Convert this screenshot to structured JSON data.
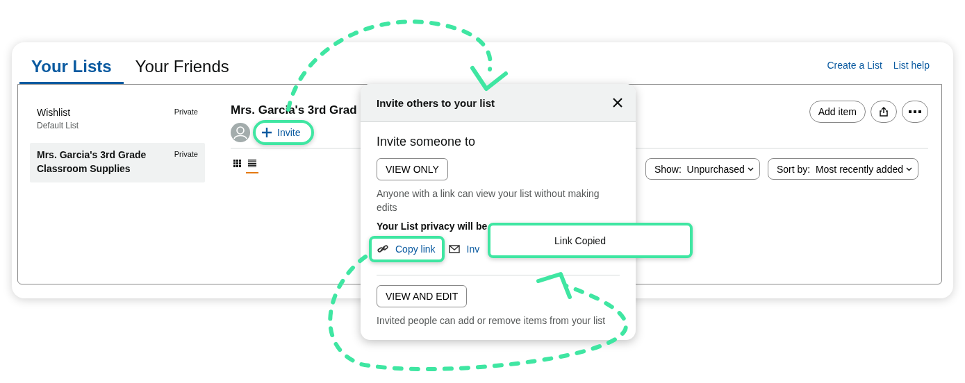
{
  "tabs": [
    {
      "label": "Your Lists",
      "selected": true
    },
    {
      "label": "Your Friends",
      "selected": false
    }
  ],
  "header_links": [
    "Create a List",
    "List help"
  ],
  "sidebar": {
    "items": [
      {
        "name": "Wishlist",
        "subtitle": "Default List",
        "privacy": "Private",
        "selected": false
      },
      {
        "name": "Mrs. Garcia's 3rd Grade Classroom Supplies",
        "privacy": "Private",
        "selected": true
      }
    ]
  },
  "list": {
    "title": "Mrs. Garcia's 3rd Grad",
    "invite": {
      "label": "Invite",
      "highlighted": true
    },
    "add_item": "Add item",
    "view_modes": [
      {
        "kind": "grid",
        "selected": false
      },
      {
        "kind": "list",
        "selected": true
      }
    ],
    "filters": [
      {
        "label": "Show:",
        "value": "Unpurchased"
      },
      {
        "label": "Sort by:",
        "value": "Most recently added"
      }
    ]
  },
  "invite_dialog": {
    "title": "Invite others to your list",
    "heading": "Invite someone to",
    "options": [
      {
        "button": "VIEW ONLY",
        "description": "Anyone with a link can view your list without making edits",
        "privacy_note": "Your List privacy will be",
        "share_links": [
          {
            "kind": "link",
            "label": "Copy link",
            "highlighted": true
          },
          {
            "kind": "email",
            "label": "Inv",
            "highlighted": false
          }
        ]
      },
      {
        "button": "VIEW AND EDIT",
        "description": "Invited people can add or remove items from your list"
      }
    ]
  },
  "toast": {
    "text": "Link Copied"
  }
}
